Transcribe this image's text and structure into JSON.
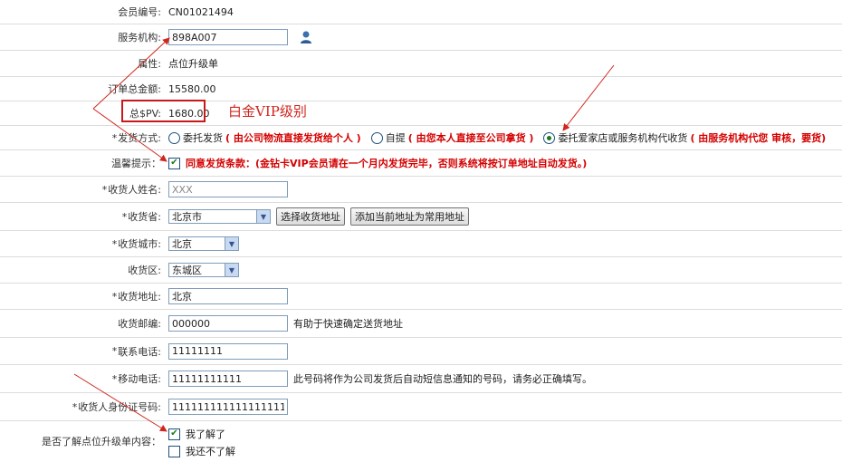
{
  "fields": {
    "member_id": {
      "label": "会员编号:",
      "value": "CN01021494"
    },
    "service_org": {
      "label": "服务机构:",
      "value": "898A007"
    },
    "attribute": {
      "label": "属性:",
      "value": "点位升级单"
    },
    "order_total": {
      "label": "订单总金额:",
      "value": "15580.00"
    },
    "total_spv": {
      "label": "总$PV:",
      "value": "1680.00"
    },
    "shipping": {
      "label": "发货方式:",
      "options": [
        {
          "label": "委托发货",
          "note": "( 由公司物流直接发货给个人 )"
        },
        {
          "label": "自提",
          "note": "( 由您本人直接至公司拿货 )"
        },
        {
          "label": "委托爱家店或服务机构代收货",
          "note": "( 由服务机构代您 审核，要货)"
        }
      ]
    },
    "reminder": {
      "label": "温馨提示：",
      "text": "同意发货条款：(金钻卡VIP会员请在一个月内发货完毕，否则系统将按订单地址自动发货。)"
    },
    "receiver_name": {
      "label": "收货人姓名:",
      "value": "XXX"
    },
    "province": {
      "label": "收货省:",
      "value": "北京市",
      "btn_choose": "选择收货地址",
      "btn_add": "添加当前地址为常用地址"
    },
    "city": {
      "label": "收货城市:",
      "value": "北京"
    },
    "district": {
      "label": "收货区:",
      "value": "东城区"
    },
    "address": {
      "label": "收货地址:",
      "value": "北京"
    },
    "postcode": {
      "label": "收货邮编:",
      "value": "000000",
      "hint": "有助于快速确定送货地址"
    },
    "phone": {
      "label": "联系电话:",
      "value": "11111111"
    },
    "mobile": {
      "label": "移动电话:",
      "value": "11111111111",
      "hint": "此号码将作为公司发货后自动短信息通知的号码，请务必正确填写。"
    },
    "id_number": {
      "label": "收货人身份证号码:",
      "value": "111111111111111111"
    },
    "understand": {
      "label": "是否了解点位升级单内容：",
      "yes": "我了解了",
      "no": "我还不了解"
    }
  },
  "annotation": {
    "text": "白金VIP级别",
    "color": "#d0261e"
  },
  "required_mark": "*",
  "colors": {
    "red_note": "#d40000",
    "border": "#7f9db9",
    "annotation": "#d0261e"
  }
}
